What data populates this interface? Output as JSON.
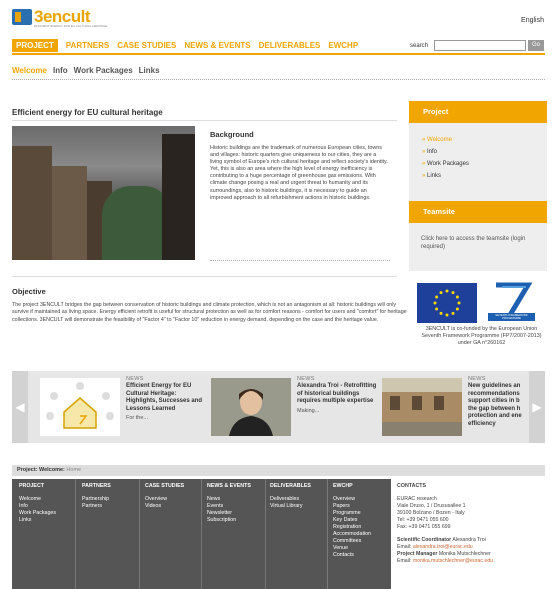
{
  "header": {
    "logo_text": "3encult",
    "tagline": "EFFICIENT ENERGY FOR EU CULTURAL HERITAGE",
    "language": "English"
  },
  "nav": {
    "items": [
      "PROJECT",
      "PARTNERS",
      "CASE STUDIES",
      "NEWS & EVENTS",
      "DELIVERABLES",
      "EWCHP"
    ],
    "active": "PROJECT"
  },
  "search": {
    "label": "search",
    "value": "",
    "button": "Go"
  },
  "subnav": {
    "items": [
      "Welcome",
      "Info",
      "Work Packages",
      "Links"
    ],
    "active": "Welcome"
  },
  "main": {
    "title": "Efficient energy for EU cultural heritage",
    "background_title": "Background",
    "background_text": "Historic buildings are the trademark of numerous European cities, towns and villages: historic quarters give uniqueness to our cities, they are a living symbol of Europe's rich cultural heritage and reflect society's identity. Yet, this is also an area where the high level of energy inefficiency is contributing to a huge percentage of greenhouse gas emissions. With climate change posing a real and urgent threat to humanity and its surroundings, also to historic buildings, it is necessary to guide an improved approach to all refurbishment actions in historic buildings.",
    "objective_title": "Objective",
    "objective_text": "The project 3ENCULT bridges the gap between conservation of historic buildings and climate protection, which is not an antagonism at all: historic buildings will only survive if maintained as living space. Energy efficient retrofit is useful for structural protection as well as for comfort reasons - comfort for users and \"comfort\" for heritage collections. 3ENCULT will demonstrate the feasibility of \"Factor 4\" to \"Factor 10\" reduction in energy demand, depending on the case and the heritage value."
  },
  "sidebar": {
    "project_title": "Project",
    "project_links": [
      "Welcome",
      "Info",
      "Work Packages",
      "Links"
    ],
    "teamsite_title": "Teamsite",
    "teamsite_text": "Click here to access the teamsite (login required)",
    "eu_text": "3ENCULT is co-funded by the European Union Seventh Framework Programme (FP7/2007-2013) under GA n°260162",
    "fp7_label": "SEVENTH FRAMEWORK PROGRAMME"
  },
  "carousel": [
    {
      "tag": "NEWS",
      "title": "Efficient Energy for EU Cultural Heritage: Highlights, Successes and Lessons Learned",
      "more": "For the..."
    },
    {
      "tag": "NEWS",
      "title": "Alexandra Troi - Retrofitting of historical buildings requires multiple expertise",
      "more": "Making..."
    },
    {
      "tag": "NEWS",
      "title": "New guidelines an recommendations support cities in b the gap between h protection and ene efficiency",
      "more": ""
    }
  ],
  "breadcrumb": {
    "path": "Project: Welcome:",
    "current": "Home"
  },
  "footer": {
    "columns": [
      {
        "title": "PROJECT",
        "links": [
          "Welcome",
          "Info",
          "Work Packages",
          "Links"
        ]
      },
      {
        "title": "PARTNERS",
        "links": [
          "Partnership",
          "Partners"
        ]
      },
      {
        "title": "CASE STUDIES",
        "links": [
          "Overview",
          "Videos"
        ]
      },
      {
        "title": "NEWS & EVENTS",
        "links": [
          "News",
          "Events",
          "Newsletter",
          "Subscription"
        ]
      },
      {
        "title": "DELIVERABLES",
        "links": [
          "Deliverables",
          "Virtual Library"
        ]
      },
      {
        "title": "EWCHP",
        "links": [
          "Overview",
          "Papers",
          "Programme",
          "Key Dates",
          "Registration",
          "Accommodation",
          "Committees",
          "Venue",
          "Contacts"
        ]
      }
    ],
    "contacts": {
      "title": "CONTACTS",
      "org": "EURAC research",
      "address1": "Viale Druso, 1 / Drususallee 1",
      "address2": "39100 Bolzano / Bozen - Italy",
      "tel": "Tel: +39 0471 055 600",
      "fax": "Fax: +39 0471 055 699",
      "coord_label": "Scientific Coordinator",
      "coord_name": "Alexandra Troi",
      "coord_email_label": "Email:",
      "coord_email": "alexandra.troi@eurac.edu",
      "pm_label": "Project Manager",
      "pm_name": "Monika Mutschlechner",
      "pm_email_label": "Email:",
      "pm_email": "monika.mutschlechner@eurac.edu"
    }
  },
  "colors": {
    "accent": "#f0a500",
    "brand_blue": "#2a6fb0",
    "footer_bg": "#555555"
  }
}
